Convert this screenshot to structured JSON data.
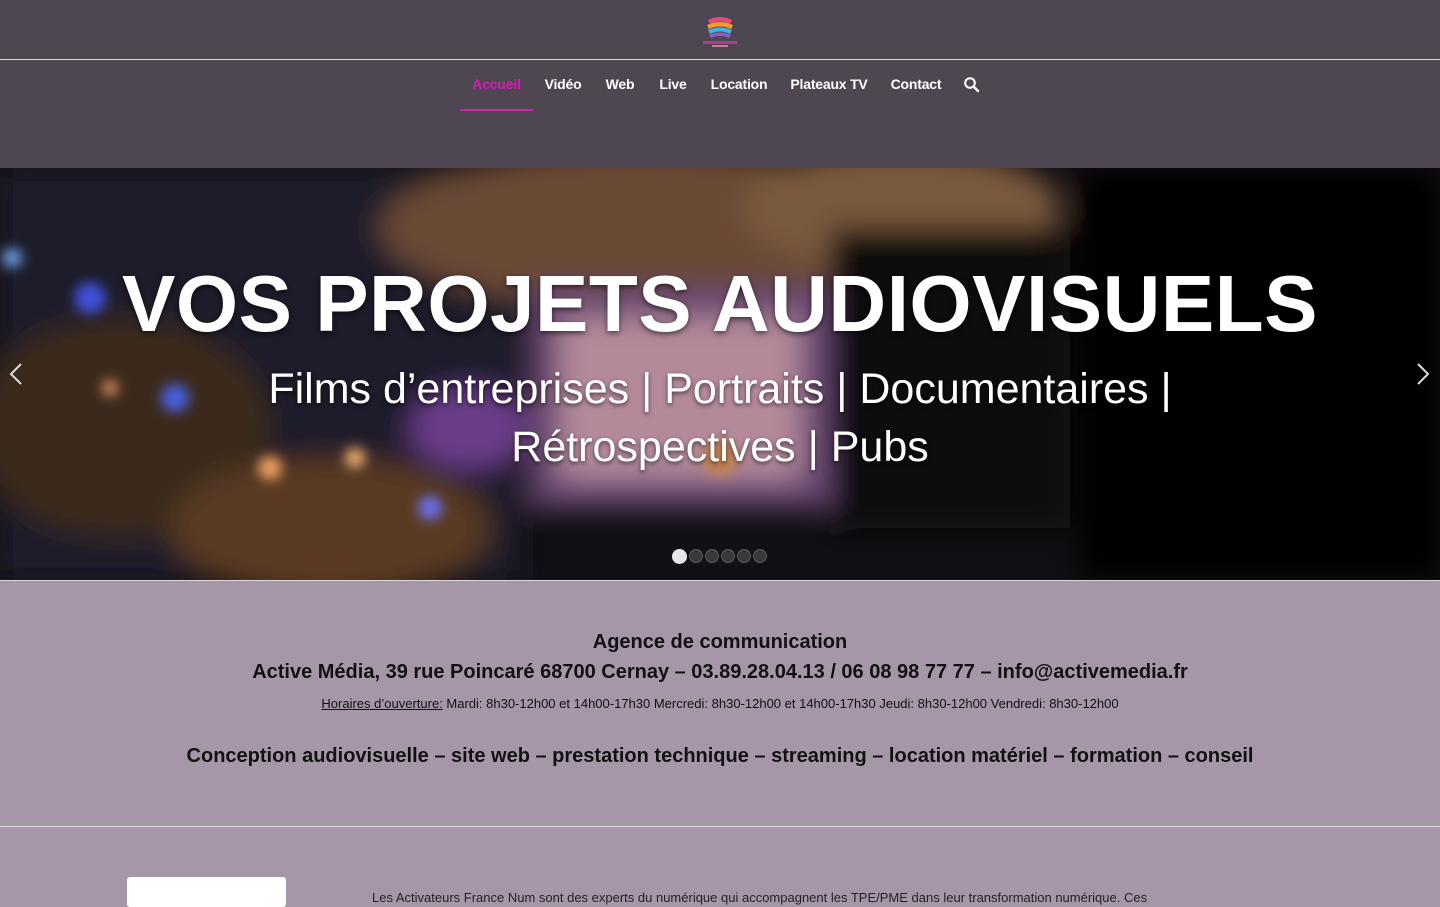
{
  "header": {
    "logo_icon": "activemedia-logo",
    "nav": [
      {
        "label": "Accueil",
        "active": true
      },
      {
        "label": "Vidéo",
        "active": false
      },
      {
        "label": "Web",
        "active": false
      },
      {
        "label": "Live",
        "active": false
      },
      {
        "label": "Location",
        "active": false
      },
      {
        "label": "Plateaux TV",
        "active": false
      },
      {
        "label": "Contact",
        "active": false
      }
    ],
    "search_icon": "search-icon"
  },
  "hero": {
    "title": "VOS PROJETS AUDIOVISUELS",
    "subtitle_line1": "Films d’entreprises | Portraits | Documentaires |",
    "subtitle_line2": "Rétrospectives | Pubs",
    "prev_icon": "chevron-left-icon",
    "next_icon": "chevron-right-icon",
    "slide_count": 6,
    "active_slide": 1
  },
  "info": {
    "agency": "Agence de communication",
    "address": "Active Média, 39 rue Poincaré 68700 Cernay – 03.89.28.04.13 / 06 08 98 77 77 – info@activemedia.fr",
    "hours_label": "Horaires d’ouverture:",
    "hours_text": " Mardi: 8h30-12h00 et 14h00-17h30 Mercredi: 8h30-12h00 et 14h00-17h30 Jeudi: 8h30-12h00 Vendredi: 8h30-12h00",
    "services": "Conception audiovisuelle  – site web – prestation technique – streaming – location matériel – formation – conseil"
  },
  "bottom": {
    "text": "Les Activateurs France Num sont des experts du numérique qui accompagnent les TPE/PME dans leur transformation numérique. Ces"
  },
  "colors": {
    "header_bg": "#4e4650",
    "accent": "#d91bb5",
    "section_bg": "#a597a8"
  }
}
